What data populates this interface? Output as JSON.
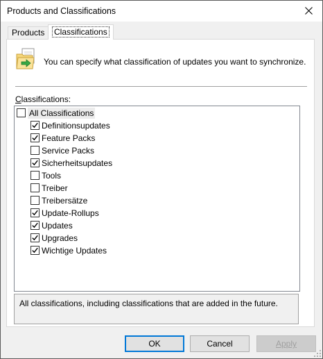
{
  "window": {
    "title": "Products and Classifications",
    "close_icon": "close-icon"
  },
  "tabs": [
    {
      "label": "Products",
      "selected": false
    },
    {
      "label": "Classifications",
      "selected": true
    }
  ],
  "header": {
    "icon": "folder-sync-icon",
    "info_text": "You can specify what classification of updates you want to synchronize."
  },
  "classifications": {
    "label": "Classifications:",
    "root": {
      "label": "All Classifications",
      "checked": false
    },
    "items": [
      {
        "label": "Definitionsupdates",
        "checked": true
      },
      {
        "label": "Feature Packs",
        "checked": true
      },
      {
        "label": "Service Packs",
        "checked": false
      },
      {
        "label": "Sicherheitsupdates",
        "checked": true
      },
      {
        "label": "Tools",
        "checked": false
      },
      {
        "label": "Treiber",
        "checked": false
      },
      {
        "label": "Treibersätze",
        "checked": false
      },
      {
        "label": "Update-Rollups",
        "checked": true
      },
      {
        "label": "Updates",
        "checked": true
      },
      {
        "label": "Upgrades",
        "checked": true
      },
      {
        "label": "Wichtige Updates",
        "checked": true
      }
    ]
  },
  "description": "All classifications, including classifications that are added in the future.",
  "buttons": {
    "ok": "OK",
    "cancel": "Cancel",
    "apply": "Apply",
    "apply_enabled": false
  },
  "colors": {
    "accent": "#0078d7",
    "folder": "#f5d67a",
    "arrow": "#39a845"
  }
}
